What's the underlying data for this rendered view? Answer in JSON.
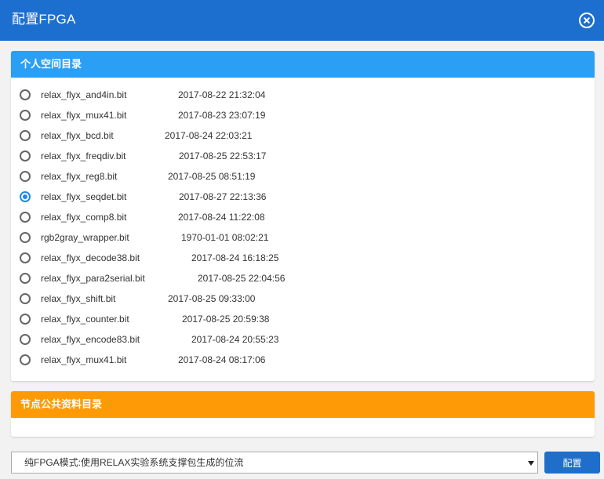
{
  "colors": {
    "title_bg": "#1d6fcf",
    "blue_header": "#2b9ff3",
    "orange_header": "#fd9a05",
    "button_bg": "#1f6fca",
    "radio_checked": "#1e88e5"
  },
  "dialog": {
    "title": "配置FPGA",
    "close_icon": "close-circle-icon"
  },
  "personal_panel": {
    "title": "个人空间目录",
    "files": [
      {
        "name": "relax_flyx_and4in.bit",
        "date": "2017-08-22 21:32:04",
        "checked": false
      },
      {
        "name": "relax_flyx_mux41.bit",
        "date": "2017-08-23 23:07:19",
        "checked": false
      },
      {
        "name": "relax_flyx_bcd.bit",
        "date": "2017-08-24 22:03:21",
        "checked": false
      },
      {
        "name": "relax_flyx_freqdiv.bit",
        "date": "2017-08-25 22:53:17",
        "checked": false
      },
      {
        "name": "relax_flyx_reg8.bit",
        "date": "2017-08-25 08:51:19",
        "checked": false
      },
      {
        "name": "relax_flyx_seqdet.bit",
        "date": "2017-08-27 22:13:36",
        "checked": true
      },
      {
        "name": "relax_flyx_comp8.bit",
        "date": "2017-08-24 11:22:08",
        "checked": false
      },
      {
        "name": "rgb2gray_wrapper.bit",
        "date": "1970-01-01 08:02:21",
        "checked": false
      },
      {
        "name": "relax_flyx_decode38.bit",
        "date": "2017-08-24 16:18:25",
        "checked": false
      },
      {
        "name": "relax_flyx_para2serial.bit",
        "date": "2017-08-25 22:04:56",
        "checked": false
      },
      {
        "name": "relax_flyx_shift.bit",
        "date": "2017-08-25 09:33:00",
        "checked": false
      },
      {
        "name": "relax_flyx_counter.bit",
        "date": "2017-08-25 20:59:38",
        "checked": false
      },
      {
        "name": "relax_flyx_encode83.bit",
        "date": "2017-08-24 20:55:23",
        "checked": false
      },
      {
        "name": "relax_flyx_mux41.bit",
        "date": "2017-08-24 08:17:06",
        "checked": false
      }
    ]
  },
  "public_panel": {
    "title": "节点公共资料目录"
  },
  "footer": {
    "mode_selected": "纯FPGA模式:使用RELAX实验系统支撑包生成的位流",
    "dropdown_icon": "chevron-down-icon",
    "config_button": "配置"
  }
}
